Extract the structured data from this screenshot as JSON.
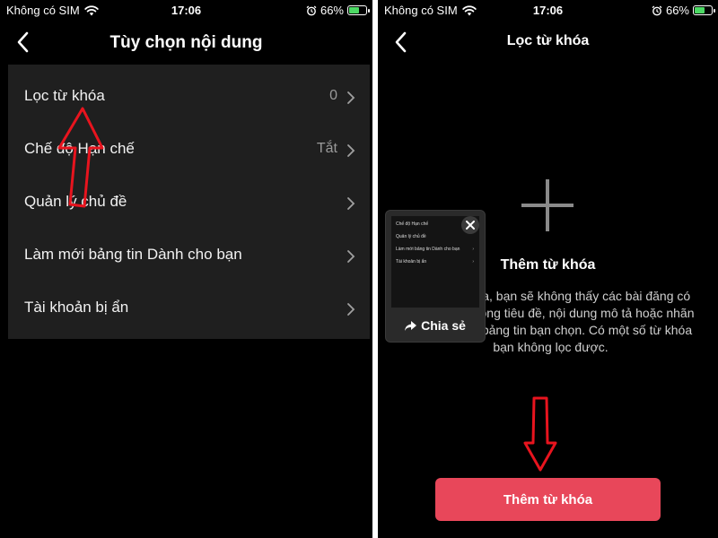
{
  "left": {
    "status": {
      "carrier": "Không có SIM",
      "time": "17:06",
      "battery": "66%",
      "battery_level": 0.66
    },
    "title": "Tùy chọn nội dung",
    "menu": [
      {
        "label": "Lọc từ khóa",
        "value": "0"
      },
      {
        "label": "Chế độ Hạn chế",
        "value": "Tắt"
      },
      {
        "label": "Quản lý chủ đề",
        "value": ""
      },
      {
        "label": "Làm mới bảng tin Dành cho bạn",
        "value": ""
      },
      {
        "label": "Tài khoản bị ẩn",
        "value": ""
      }
    ]
  },
  "right": {
    "status": {
      "carrier": "Không có SIM",
      "time": "17:06",
      "battery": "66%",
      "battery_level": 0.66
    },
    "title": "Lọc từ khóa",
    "heading": "Thêm từ khóa",
    "description": "Thêm từ khóa, bạn sẽ không thấy các bài đăng có chứa từ đó trong tiêu đề, nội dung mô tả hoặc nhãn dán trên các bảng tin bạn chọn. Có một số từ khóa bạn không lọc được.",
    "button_label": "Thêm từ khóa",
    "share": {
      "label": "Chia sẻ",
      "preview_items": [
        "Chế độ Hạn chế",
        "Quản lý chủ đề",
        "Làm mới bảng tin Dành cho bạn",
        "Tài khoản bị ẩn"
      ]
    }
  },
  "colors": {
    "accent": "#e8475a",
    "annotation": "#e8141e",
    "panel": "#1f1f1f",
    "background": "#000000"
  },
  "icons": [
    "wifi-icon",
    "battery-icon",
    "alarm-icon",
    "chevron-left-icon",
    "chevron-right-icon",
    "plus-icon",
    "close-icon",
    "share-icon",
    "arrow-annotation"
  ]
}
